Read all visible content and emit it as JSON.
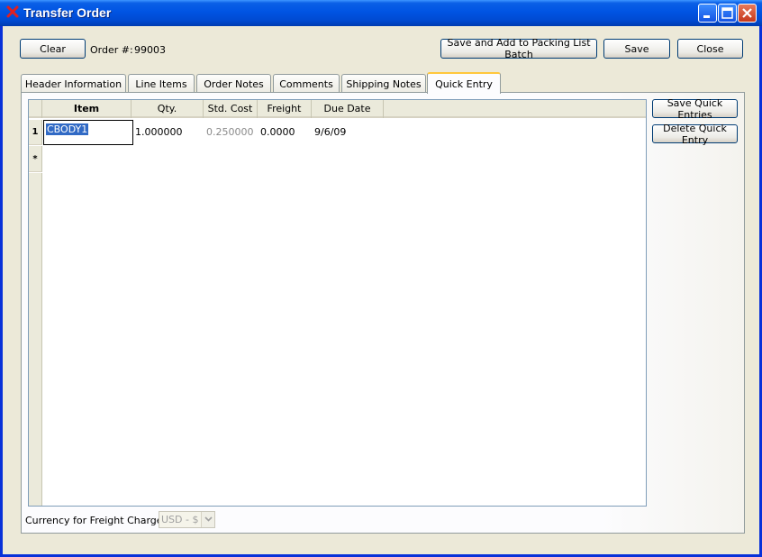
{
  "window": {
    "title": "Transfer Order"
  },
  "toolbar": {
    "clear_label": "Clear",
    "order_label": "Order #:",
    "order_number": "99003",
    "save_and_add_label": "Save and Add to Packing List Batch",
    "save_label": "Save",
    "close_label": "Close"
  },
  "tabs": [
    {
      "label": "Header Information"
    },
    {
      "label": "Line Items"
    },
    {
      "label": "Order Notes"
    },
    {
      "label": "Comments"
    },
    {
      "label": "Shipping Notes"
    },
    {
      "label": "Quick Entry"
    }
  ],
  "active_tab": "Quick Entry",
  "grid": {
    "columns": [
      "Item",
      "Qty.",
      "Std. Cost",
      "Freight",
      "Due Date"
    ],
    "rows": [
      {
        "row_label": "1",
        "item": "CBODY1",
        "qty": "1.000000",
        "std_cost": "0.250000",
        "freight": "0.0000",
        "due_date": "9/6/09"
      }
    ],
    "new_row_marker": "*"
  },
  "side_buttons": {
    "save_quick_label": "Save Quick Entries",
    "delete_quick_label": "Delete Quick Entry"
  },
  "currency": {
    "label": "Currency for Freight Charges:",
    "value": "USD - $"
  },
  "colors": {
    "titlebar": "#0054e3",
    "selection": "#316ac5",
    "active_tab_accent": "#ffc73c"
  }
}
